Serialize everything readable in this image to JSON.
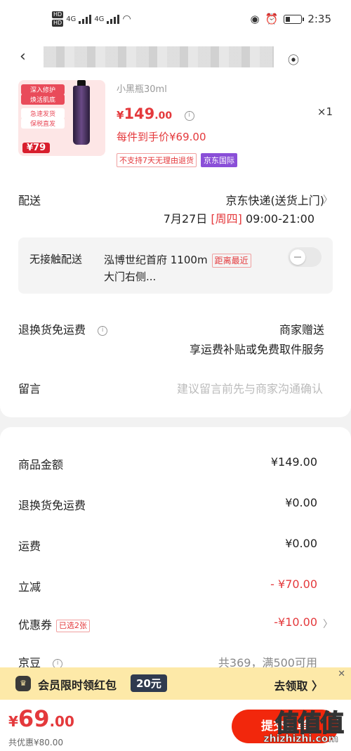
{
  "status_bar": {
    "hd1": "HD",
    "hd2": "HD",
    "net1": "4G",
    "net2": "4G",
    "time": "2:35"
  },
  "product": {
    "thumb_tag1": "深入修护",
    "thumb_tag2": "焕活肌底",
    "thumb_tag3": "急速发货",
    "thumb_tag4": "保税直发",
    "thumb_price": "¥79",
    "variant": "小黑瓶30ml",
    "price_symbol": "¥",
    "price_int": "149",
    "price_dec": ".00",
    "quantity": "×1",
    "each_price": "每件到手价¥69.00",
    "badge_no_return": "不支持7天无理由退货",
    "badge_jd_intl": "京东国际"
  },
  "delivery": {
    "label": "配送",
    "method": "京东快递(送货上门)",
    "date": "7月27日",
    "weekday": "[周四]",
    "time_range": "09:00-21:00"
  },
  "no_contact": {
    "label": "无接触配送",
    "address_line1": "泓博世纪首府  1100m",
    "nearest_badge": "距离最近",
    "address_line2": "大门右侧..."
  },
  "return_shipping": {
    "label": "退换货免运费",
    "line1": "商家赠送",
    "line2": "享运费补贴或免费取件服务"
  },
  "message": {
    "label": "留言",
    "placeholder": "建议留言前先与商家沟通确认"
  },
  "summary": {
    "goods_label": "商品金额",
    "goods_value": "¥149.00",
    "return_label": "退换货免运费",
    "return_value": "¥0.00",
    "freight_label": "运费",
    "freight_value": "¥0.00",
    "discount_label": "立减",
    "discount_value": "- ¥70.00",
    "coupon_label": "优惠券",
    "coupon_badge": "已选2张",
    "coupon_value": "-¥10.00",
    "jingdou_label": "京豆",
    "jingdou_value": "共369，满500可用"
  },
  "promo": {
    "text": "会员限时领红包",
    "amount": "20元",
    "action": "去领取 〉"
  },
  "bottom": {
    "total_symbol": "¥",
    "total_int": "69",
    "total_dec": ".00",
    "saved": "共优惠¥80.00",
    "submit": "提交订单",
    "watermark_logo": "值值值",
    "watermark_site": "zhizhizhi.com"
  },
  "colors": {
    "accent_red": "#e4393c",
    "submit_red": "#f2270c",
    "promo_bg": "#fde9a8",
    "jd_intl_purple": "#8a4fd8"
  }
}
